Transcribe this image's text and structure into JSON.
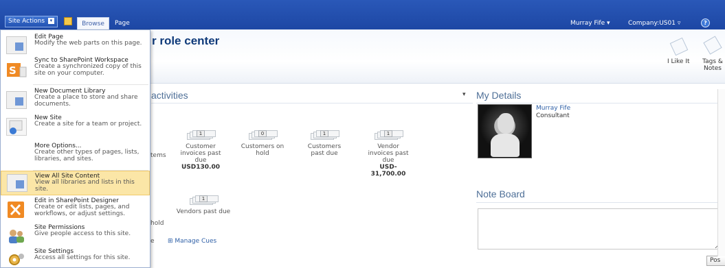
{
  "topbar": {
    "site_actions_label": "Site Actions",
    "browse_tab": "Browse",
    "page_tab": "Page",
    "user_name": "Murray Fife",
    "company": "Company:US01",
    "help_glyph": "?"
  },
  "page": {
    "title": "r role center",
    "like_label": "I Like It",
    "tags_label": "Tags & Notes"
  },
  "site_actions_menu": [
    {
      "name": "Edit Page",
      "desc": "Modify the web parts on this page.",
      "icon": "edit-page-icon"
    },
    {
      "name": "Sync to SharePoint Workspace",
      "desc": "Create a synchronized copy of this site on your computer.",
      "icon": "sync-icon"
    },
    {
      "name": "New Document Library",
      "desc": "Create a place to store and share documents.",
      "icon": "document-library-icon"
    },
    {
      "name": "New Site",
      "desc": "Create a site for a team or project.",
      "icon": "new-site-icon"
    },
    {
      "name": "More Options...",
      "desc": "Create other types of pages, lists, libraries, and sites.",
      "icon": ""
    },
    {
      "name": "View All Site Content",
      "desc": "View all libraries and lists in this site.",
      "icon": "site-content-icon"
    },
    {
      "name": "Edit in SharePoint Designer",
      "desc": "Create or edit lists, pages, and workflows, or adjust settings.",
      "icon": "designer-icon"
    },
    {
      "name": "Site Permissions",
      "desc": "Give people access to this site.",
      "icon": "permissions-icon"
    },
    {
      "name": "Site Settings",
      "desc": "Access all settings for this site.",
      "icon": "settings-icon"
    }
  ],
  "activities": {
    "title": "activities",
    "menu_glyph": "▾",
    "cues_row1": [
      {
        "count": "1",
        "label": "Customer invoices past due",
        "value": "USD130.00"
      },
      {
        "count": "0",
        "label": "Customers on hold",
        "value": ""
      },
      {
        "count": "1",
        "label": "Customers past due",
        "value": ""
      },
      {
        "count": "1",
        "label": "Vendor invoices past due",
        "value": "USD-31,700.00"
      }
    ],
    "cues_row2": [
      {
        "count": "1",
        "label": "Vendors past due",
        "value": ""
      }
    ],
    "partial_items": "tems",
    "partial_hold": "hold",
    "partial_e": "e",
    "manage_cues": "Manage Cues"
  },
  "my_details": {
    "title": "My Details",
    "name": "Murray Fife",
    "job_title": "Consultant"
  },
  "note_board": {
    "title": "Note Board",
    "post_label": "Pos"
  }
}
